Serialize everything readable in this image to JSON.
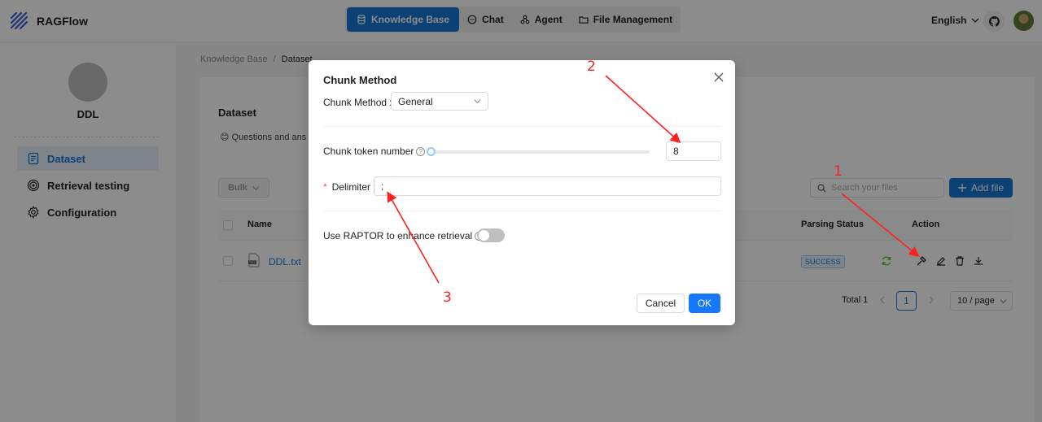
{
  "app": {
    "brand": "RAGFlow",
    "language": "English"
  },
  "nav": {
    "items": [
      {
        "label": "Knowledge Base",
        "icon": "database-icon",
        "active": true
      },
      {
        "label": "Chat",
        "icon": "chat-icon",
        "active": false
      },
      {
        "label": "Agent",
        "icon": "agent-icon",
        "active": false
      },
      {
        "label": "File Management",
        "icon": "folder-icon",
        "active": false
      }
    ]
  },
  "sidebar": {
    "kb_name": "DDL",
    "items": [
      {
        "label": "Dataset",
        "icon": "document-icon",
        "active": true
      },
      {
        "label": "Retrieval testing",
        "icon": "target-icon",
        "active": false
      },
      {
        "label": "Configuration",
        "icon": "gear-icon",
        "active": false
      }
    ]
  },
  "breadcrumb": {
    "root": "Knowledge Base",
    "sep": "/",
    "current": "Dataset"
  },
  "dataset": {
    "title": "Dataset",
    "description": "😊 Questions and ans",
    "bulk_label": "Bulk",
    "search_placeholder": "Search your files",
    "add_file_label": "Add file",
    "columns": {
      "name": "Name",
      "parsing_status": "Parsing Status",
      "action": "Action"
    },
    "rows": [
      {
        "name": "DDL.txt",
        "status": "SUCCESS"
      }
    ],
    "pagination": {
      "total": "Total 1",
      "current_page": "1",
      "page_size": "10 / page"
    }
  },
  "modal": {
    "title": "Chunk Method",
    "chunk_method_label": "Chunk Method",
    "chunk_method_value": "General",
    "chunk_token_label": "Chunk token number",
    "chunk_token_value": "8",
    "chunk_token_fraction": 0.0,
    "delimiter_label": "Delimiter",
    "delimiter_value": ";",
    "raptor_label": "Use RAPTOR to enhance retrieval",
    "raptor_enabled": false,
    "cancel_label": "Cancel",
    "ok_label": "OK"
  },
  "annotations": {
    "labels": [
      "1",
      "2",
      "3"
    ],
    "color": "#ff2020"
  },
  "colors": {
    "accent": "#1677d6",
    "primary_button": "#1677ff",
    "success_badge": "#1677d6"
  }
}
